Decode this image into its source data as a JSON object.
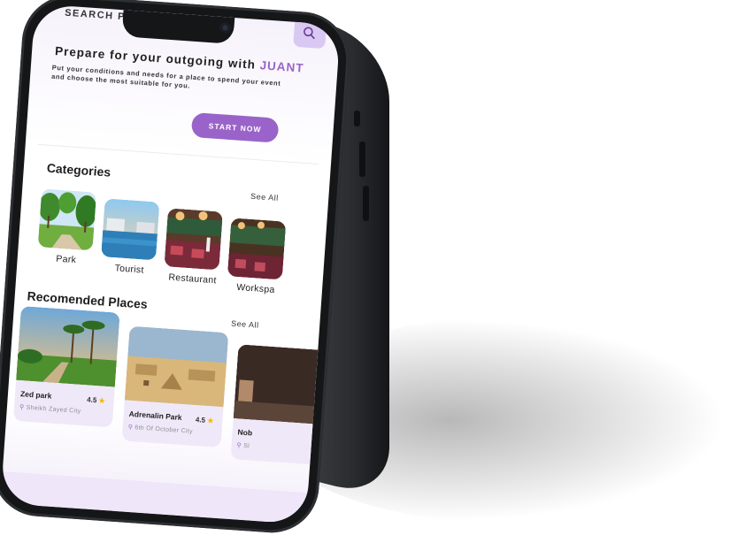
{
  "header": {
    "search_label": "SEARCH P",
    "search_icon": "search-icon"
  },
  "hero": {
    "title_prefix": "Prepare for your outgoing with",
    "brand": "JUANT",
    "subtitle": "Put your conditions and needs for a place to spend your event and choose the most suitable for you.",
    "cta_label": "START NOW"
  },
  "categories": {
    "title": "Categories",
    "see_all": "See All",
    "items": [
      {
        "label": "Park"
      },
      {
        "label": "Tourist"
      },
      {
        "label": "Restaurant"
      },
      {
        "label": "Workspa"
      }
    ]
  },
  "recommended": {
    "title": "Recomended Places",
    "see_all": "See All",
    "items": [
      {
        "name": "Zed park",
        "rating": "4.5",
        "location": "Sheikh Zayed City"
      },
      {
        "name": "Adrenalin Park",
        "rating": "4.5",
        "location": "6th Of October City"
      },
      {
        "name": "Nob",
        "rating": "",
        "location": "Sl"
      }
    ]
  },
  "colors": {
    "accent": "#9a63c9",
    "accent_light": "#d9c8f2",
    "card_bg": "#efe8f8",
    "star": "#f2b700",
    "device": "#151617"
  }
}
